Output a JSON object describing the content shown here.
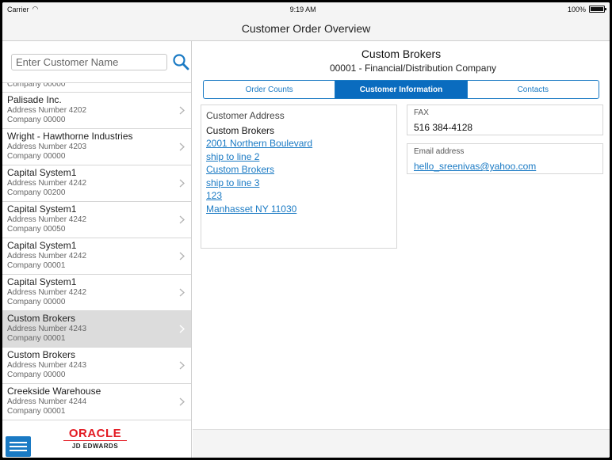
{
  "status": {
    "carrier": "Carrier",
    "time": "9:19 AM",
    "battery": "100%"
  },
  "app": {
    "title": "Customer Order Overview"
  },
  "search": {
    "placeholder": "Enter Customer Name"
  },
  "list": {
    "partial": "Company 00000",
    "rows": [
      {
        "name": "Palisade Inc.",
        "address": "Address Number 4202",
        "company": "Company 00000",
        "selected": false
      },
      {
        "name": "Wright - Hawthorne Industries",
        "address": "Address Number 4203",
        "company": "Company 00000",
        "selected": false
      },
      {
        "name": "Capital System1",
        "address": "Address Number 4242",
        "company": "Company 00200",
        "selected": false
      },
      {
        "name": "Capital System1",
        "address": "Address Number 4242",
        "company": "Company 00050",
        "selected": false
      },
      {
        "name": "Capital System1",
        "address": "Address Number 4242",
        "company": "Company 00001",
        "selected": false
      },
      {
        "name": "Capital System1",
        "address": "Address Number 4242",
        "company": "Company 00000",
        "selected": false
      },
      {
        "name": "Custom Brokers",
        "address": "Address Number 4243",
        "company": "Company 00001",
        "selected": true
      },
      {
        "name": "Custom Brokers",
        "address": "Address Number 4243",
        "company": "Company 00000",
        "selected": false
      },
      {
        "name": "Creekside Warehouse",
        "address": "Address Number 4244",
        "company": "Company 00001",
        "selected": false
      }
    ]
  },
  "logo": {
    "brand": "ORACLE",
    "product": "JD EDWARDS"
  },
  "detail": {
    "title": "Custom Brokers",
    "subtitle": "00001 - Financial/Distribution Company",
    "tabs": [
      {
        "label": "Order Counts",
        "active": false
      },
      {
        "label": "Customer Information",
        "active": true
      },
      {
        "label": "Contacts",
        "active": false
      }
    ],
    "address": {
      "label": "Customer Address",
      "name": "Custom Brokers",
      "links": [
        "2001 Northern Boulevard",
        "ship to line 2",
        "Custom Brokers",
        "ship to line 3",
        "123",
        "Manhasset NY 11030"
      ]
    },
    "fax": {
      "label": "FAX",
      "value": "516 384-4128"
    },
    "email": {
      "label": "Email address",
      "value": "hello_sreenivas@yahoo.com"
    }
  },
  "colors": {
    "accent": "#1a7ac4",
    "active_tab": "#0a6cbf",
    "selected_row": "#dcdcdc",
    "oracle_red": "#e31b23"
  }
}
